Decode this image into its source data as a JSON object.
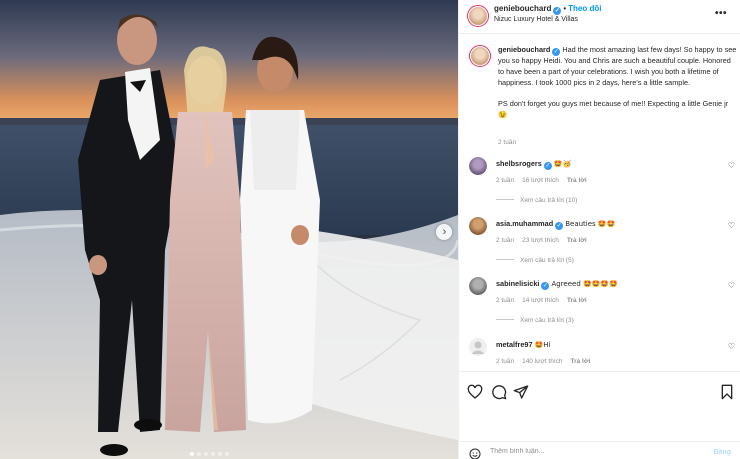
{
  "header": {
    "username": "geniebouchard",
    "separator": "•",
    "follow_label": "Theo dõi",
    "location": "Nizuc Luxury Hotel & Villas",
    "more_label": "•••"
  },
  "caption": {
    "username": "geniebouchard",
    "text": "Had the most amazing last few days! So happy to see you so happy Heidi. You and Chris are such a beautiful couple. Honored to have been a part of your celebrations. I wish you both a lifetime of happiness. I took 1000 pics in 2 days, here's a little sample.",
    "ps": "PS don't forget you guys met because of me!! Expecting a little Genie jr 😉",
    "time": "2 tuần"
  },
  "comments": [
    {
      "username": "shelbsrogers",
      "verified": true,
      "text": "🤩🥳",
      "time": "2 tuần",
      "likes": "16 lượt thích",
      "reply_label": "Trả lời",
      "replies": "Xem câu trả lời (10)",
      "avatar_color": "#7a6a8c"
    },
    {
      "username": "asia.muhammad",
      "verified": true,
      "text": "Beauties 🤩🤩",
      "time": "2 tuần",
      "likes": "23 lượt thích",
      "reply_label": "Trả lời",
      "replies": "Xem câu trả lời (5)",
      "avatar_color": "#8a5a3a"
    },
    {
      "username": "sabinelisicki",
      "verified": true,
      "text": "Agreeed 🤩🤩🤩🤩",
      "time": "2 tuần",
      "likes": "14 lượt thích",
      "reply_label": "Trả lời",
      "replies": "Xem câu trả lời (3)",
      "avatar_color": "#6a6a6a"
    },
    {
      "username": "metalfre97",
      "verified": false,
      "text": "🤩Hi",
      "time": "2 tuần",
      "likes": "140 lượt thích",
      "reply_label": "Trả lời",
      "replies": "",
      "avatar_color": "#dbdbdb"
    }
  ],
  "actions": {
    "like_icon": "heart-icon",
    "comment_icon": "comment-icon",
    "share_icon": "send-icon",
    "save_icon": "bookmark-icon"
  },
  "composer": {
    "placeholder": "Thêm bình luận...",
    "post_label": "Đăng"
  },
  "colors": {
    "accent": "#0095f6",
    "verified": "#3897f0",
    "muted": "#8e8e8e"
  }
}
